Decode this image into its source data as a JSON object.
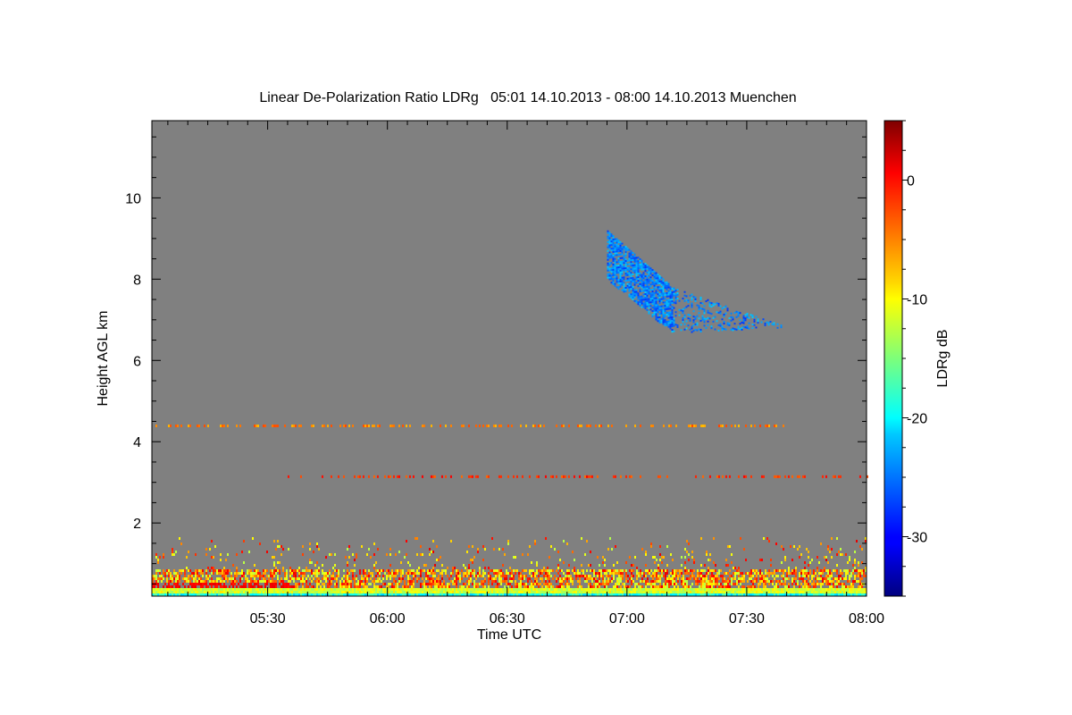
{
  "chart_data": {
    "type": "heatmap",
    "title": "Linear De-Polarization Ratio LDRg   05:01 14.10.2013 - 08:00 14.10.2013 Muenchen",
    "xlabel": "Time UTC",
    "ylabel": "Height AGL km",
    "colorbar_label": "LDRg dB",
    "xlim": [
      "05:01",
      "08:00"
    ],
    "x_minutes_range": [
      301,
      480
    ],
    "ylim": [
      0.2,
      11.9
    ],
    "x_ticks": [
      {
        "label": "05:30",
        "minutes": 330
      },
      {
        "label": "06:00",
        "minutes": 360
      },
      {
        "label": "06:30",
        "minutes": 390
      },
      {
        "label": "07:00",
        "minutes": 420
      },
      {
        "label": "07:30",
        "minutes": 450
      },
      {
        "label": "08:00",
        "minutes": 480
      }
    ],
    "y_ticks": [
      {
        "label": "2",
        "value": 2
      },
      {
        "label": "4",
        "value": 4
      },
      {
        "label": "6",
        "value": 6
      },
      {
        "label": "8",
        "value": 8
      },
      {
        "label": "10",
        "value": 10
      }
    ],
    "colorbar_range": [
      -35,
      5
    ],
    "colorbar_ticks": [
      {
        "label": "0",
        "value": 0
      },
      {
        "label": "-10",
        "value": -10
      },
      {
        "label": "-20",
        "value": -20
      },
      {
        "label": "-30",
        "value": -30
      }
    ],
    "colormap": "jet",
    "background_color": "#808080",
    "features": [
      {
        "name": "cirrus-cloud",
        "time_range": [
          "06:55",
          "07:42"
        ],
        "height_range_km": [
          6.7,
          9.3
        ],
        "ldr_db_range": [
          -28,
          -22
        ]
      },
      {
        "name": "aerosol-layer-1",
        "time_range": [
          "05:01",
          "07:40"
        ],
        "height_km": 4.4,
        "ldr_db_approx": -5
      },
      {
        "name": "aerosol-layer-2",
        "time_range": [
          "05:35",
          "08:00"
        ],
        "height_km": 3.15,
        "ldr_db_approx": -2
      },
      {
        "name": "boundary-layer",
        "time_range": [
          "05:01",
          "08:00"
        ],
        "height_range_km": [
          0.2,
          1.7
        ],
        "ldr_db_range": [
          -25,
          0
        ]
      }
    ]
  }
}
